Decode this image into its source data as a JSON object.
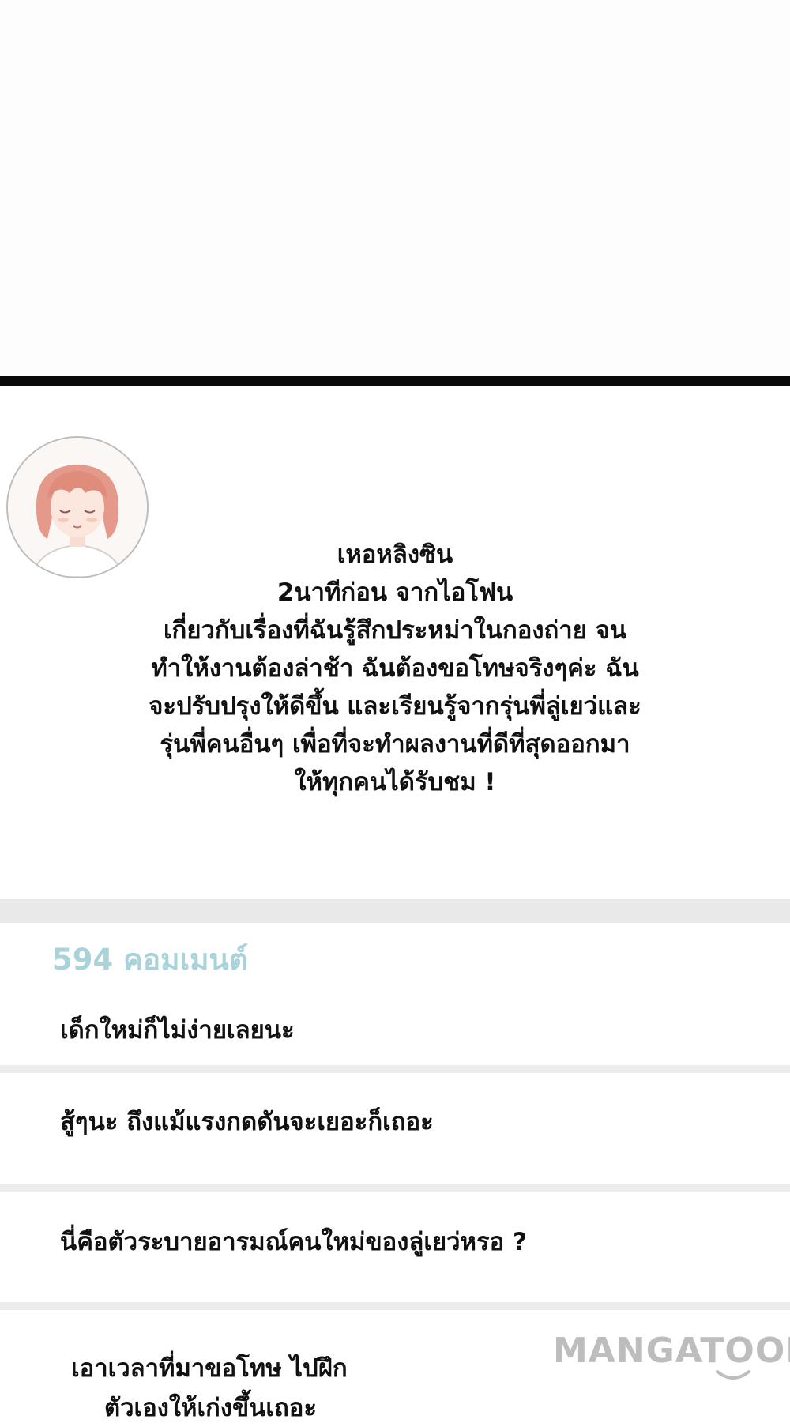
{
  "post": {
    "author": "เหอหลิงซิน",
    "meta": "2นาทีก่อน จากไอโฟน",
    "lines": [
      "เกี่ยวกับเรื่องที่ฉันรู้สึกประหม่าในกองถ่าย จน",
      "ทำให้งานต้องล่าช้า ฉันต้องขอโทษจริงๆค่ะ ฉัน",
      "จะปรับปรุงให้ดีขึ้น และเรียนรู้จากรุ่นพี่ลู่เยว่และ",
      "รุ่นพี่คนอื่นๆ เพื่อที่จะทำผลงานที่ดีที่สุดออกมา",
      "ให้ทุกคนได้รับชม !"
    ]
  },
  "comments": {
    "count_label": "594 คอมเมนต์",
    "items": [
      {
        "text": "เด็กใหม่ก็ไม่ง่ายเลยนะ"
      },
      {
        "text": "สู้ๆนะ ถึงแม้แรงกดดันจะเยอะก็เถอะ"
      },
      {
        "text": "นี่คือตัวระบายอารมณ์คนใหม่ของลู่เยว่หรอ ?"
      },
      {
        "line1": "เอาเวลาที่มาขอโทษ ไปฝึก",
        "line2": "ตัวเองให้เก่งขึ้นเถอะ"
      }
    ]
  },
  "watermark": "MANGATOON",
  "colors": {
    "count_accent": "#a9d3d9",
    "divider": "#0a0a0a",
    "separator": "#ececec",
    "watermark": "#bdbdbd"
  }
}
